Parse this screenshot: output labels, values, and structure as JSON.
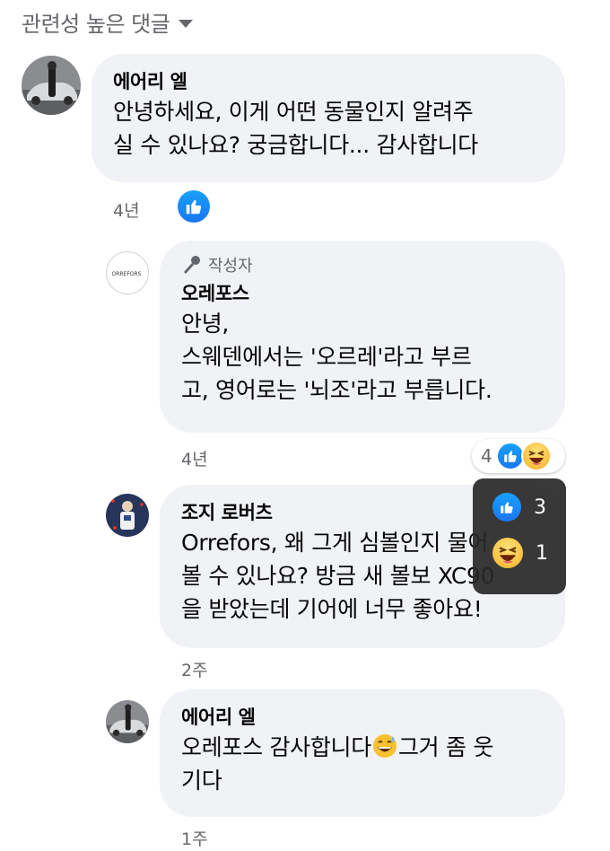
{
  "header": {
    "sort_label": "관련성 높은 댓글"
  },
  "comments": [
    {
      "author": "에어리 엘",
      "text": "안녕하세요, 이게 어떤 동물인지 알려주\n실 수 있나요? 궁금합니다... 감사합니다",
      "time": "4년"
    },
    {
      "badge": "작성자",
      "author": "오레포스",
      "avatar_text": "ORREFORS",
      "text": "안녕,\n스웨덴에서는 '오르레'라고 부르\n고, 영어로는 '뇌조'라고 부릅니다.",
      "time": "4년",
      "reaction_count": "4"
    },
    {
      "author": "조지 로버츠",
      "text": "Orrefors, 왜 그게 심볼인지 물어\n볼 수 있나요? 방금 새 볼보 XC90\n을 받았는데 기어에 너무 좋아요!",
      "time": "2주"
    },
    {
      "author": "에어리 엘",
      "text_before": "오레포스 감사합니다",
      "text_after": "그거 좀 웃\n기다",
      "time": "1주"
    }
  ],
  "tooltip": {
    "like_count": "3",
    "haha_count": "1"
  },
  "colors": {
    "bubble": "#f0f2f5",
    "meta": "#65676b",
    "like_blue": "#1877f2",
    "haha_yellow": "#f7b125"
  }
}
